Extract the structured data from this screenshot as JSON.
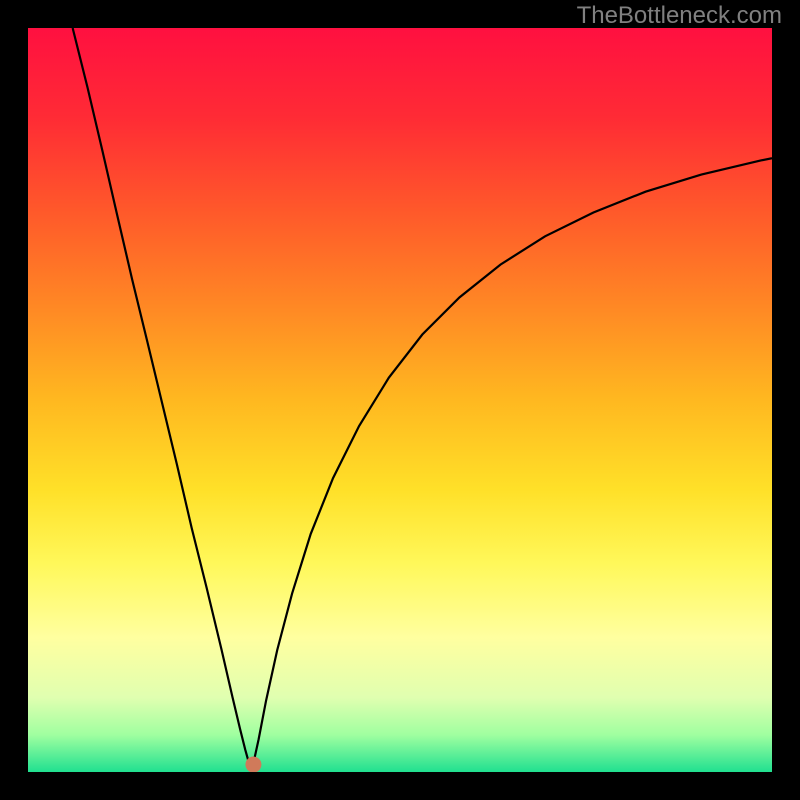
{
  "watermark": "TheBottleneck.com",
  "chart_data": {
    "type": "line",
    "title": "",
    "xlabel": "",
    "ylabel": "",
    "xlim": [
      0,
      1
    ],
    "ylim": [
      0,
      1
    ],
    "background_gradient": {
      "stops": [
        {
          "offset": 0.0,
          "color": "#ff1040"
        },
        {
          "offset": 0.12,
          "color": "#ff2b35"
        },
        {
          "offset": 0.25,
          "color": "#ff5a2a"
        },
        {
          "offset": 0.38,
          "color": "#ff8a24"
        },
        {
          "offset": 0.5,
          "color": "#ffb820"
        },
        {
          "offset": 0.62,
          "color": "#ffe028"
        },
        {
          "offset": 0.72,
          "color": "#fff85a"
        },
        {
          "offset": 0.82,
          "color": "#ffffa0"
        },
        {
          "offset": 0.9,
          "color": "#e0ffb0"
        },
        {
          "offset": 0.95,
          "color": "#a0ffa0"
        },
        {
          "offset": 1.0,
          "color": "#20e090"
        }
      ]
    },
    "series": [
      {
        "name": "curve",
        "type": "line",
        "color": "#000000",
        "x_min_point": 0.3,
        "data": [
          {
            "x": 0.06,
            "y": 1.0
          },
          {
            "x": 0.08,
            "y": 0.92
          },
          {
            "x": 0.1,
            "y": 0.835
          },
          {
            "x": 0.12,
            "y": 0.748
          },
          {
            "x": 0.14,
            "y": 0.662
          },
          {
            "x": 0.16,
            "y": 0.58
          },
          {
            "x": 0.18,
            "y": 0.497
          },
          {
            "x": 0.2,
            "y": 0.414
          },
          {
            "x": 0.22,
            "y": 0.328
          },
          {
            "x": 0.24,
            "y": 0.248
          },
          {
            "x": 0.26,
            "y": 0.165
          },
          {
            "x": 0.275,
            "y": 0.1
          },
          {
            "x": 0.285,
            "y": 0.058
          },
          {
            "x": 0.292,
            "y": 0.03
          },
          {
            "x": 0.297,
            "y": 0.012
          },
          {
            "x": 0.3,
            "y": 0.003
          },
          {
            "x": 0.303,
            "y": 0.012
          },
          {
            "x": 0.31,
            "y": 0.044
          },
          {
            "x": 0.32,
            "y": 0.096
          },
          {
            "x": 0.335,
            "y": 0.164
          },
          {
            "x": 0.355,
            "y": 0.24
          },
          {
            "x": 0.38,
            "y": 0.32
          },
          {
            "x": 0.41,
            "y": 0.395
          },
          {
            "x": 0.445,
            "y": 0.465
          },
          {
            "x": 0.485,
            "y": 0.53
          },
          {
            "x": 0.53,
            "y": 0.588
          },
          {
            "x": 0.58,
            "y": 0.638
          },
          {
            "x": 0.635,
            "y": 0.682
          },
          {
            "x": 0.695,
            "y": 0.72
          },
          {
            "x": 0.76,
            "y": 0.752
          },
          {
            "x": 0.83,
            "y": 0.78
          },
          {
            "x": 0.905,
            "y": 0.803
          },
          {
            "x": 0.985,
            "y": 0.822
          },
          {
            "x": 1.0,
            "y": 0.825
          }
        ]
      }
    ],
    "marker": {
      "x": 0.303,
      "y": 0.01,
      "color": "#d07a5a",
      "radius": 8
    }
  }
}
